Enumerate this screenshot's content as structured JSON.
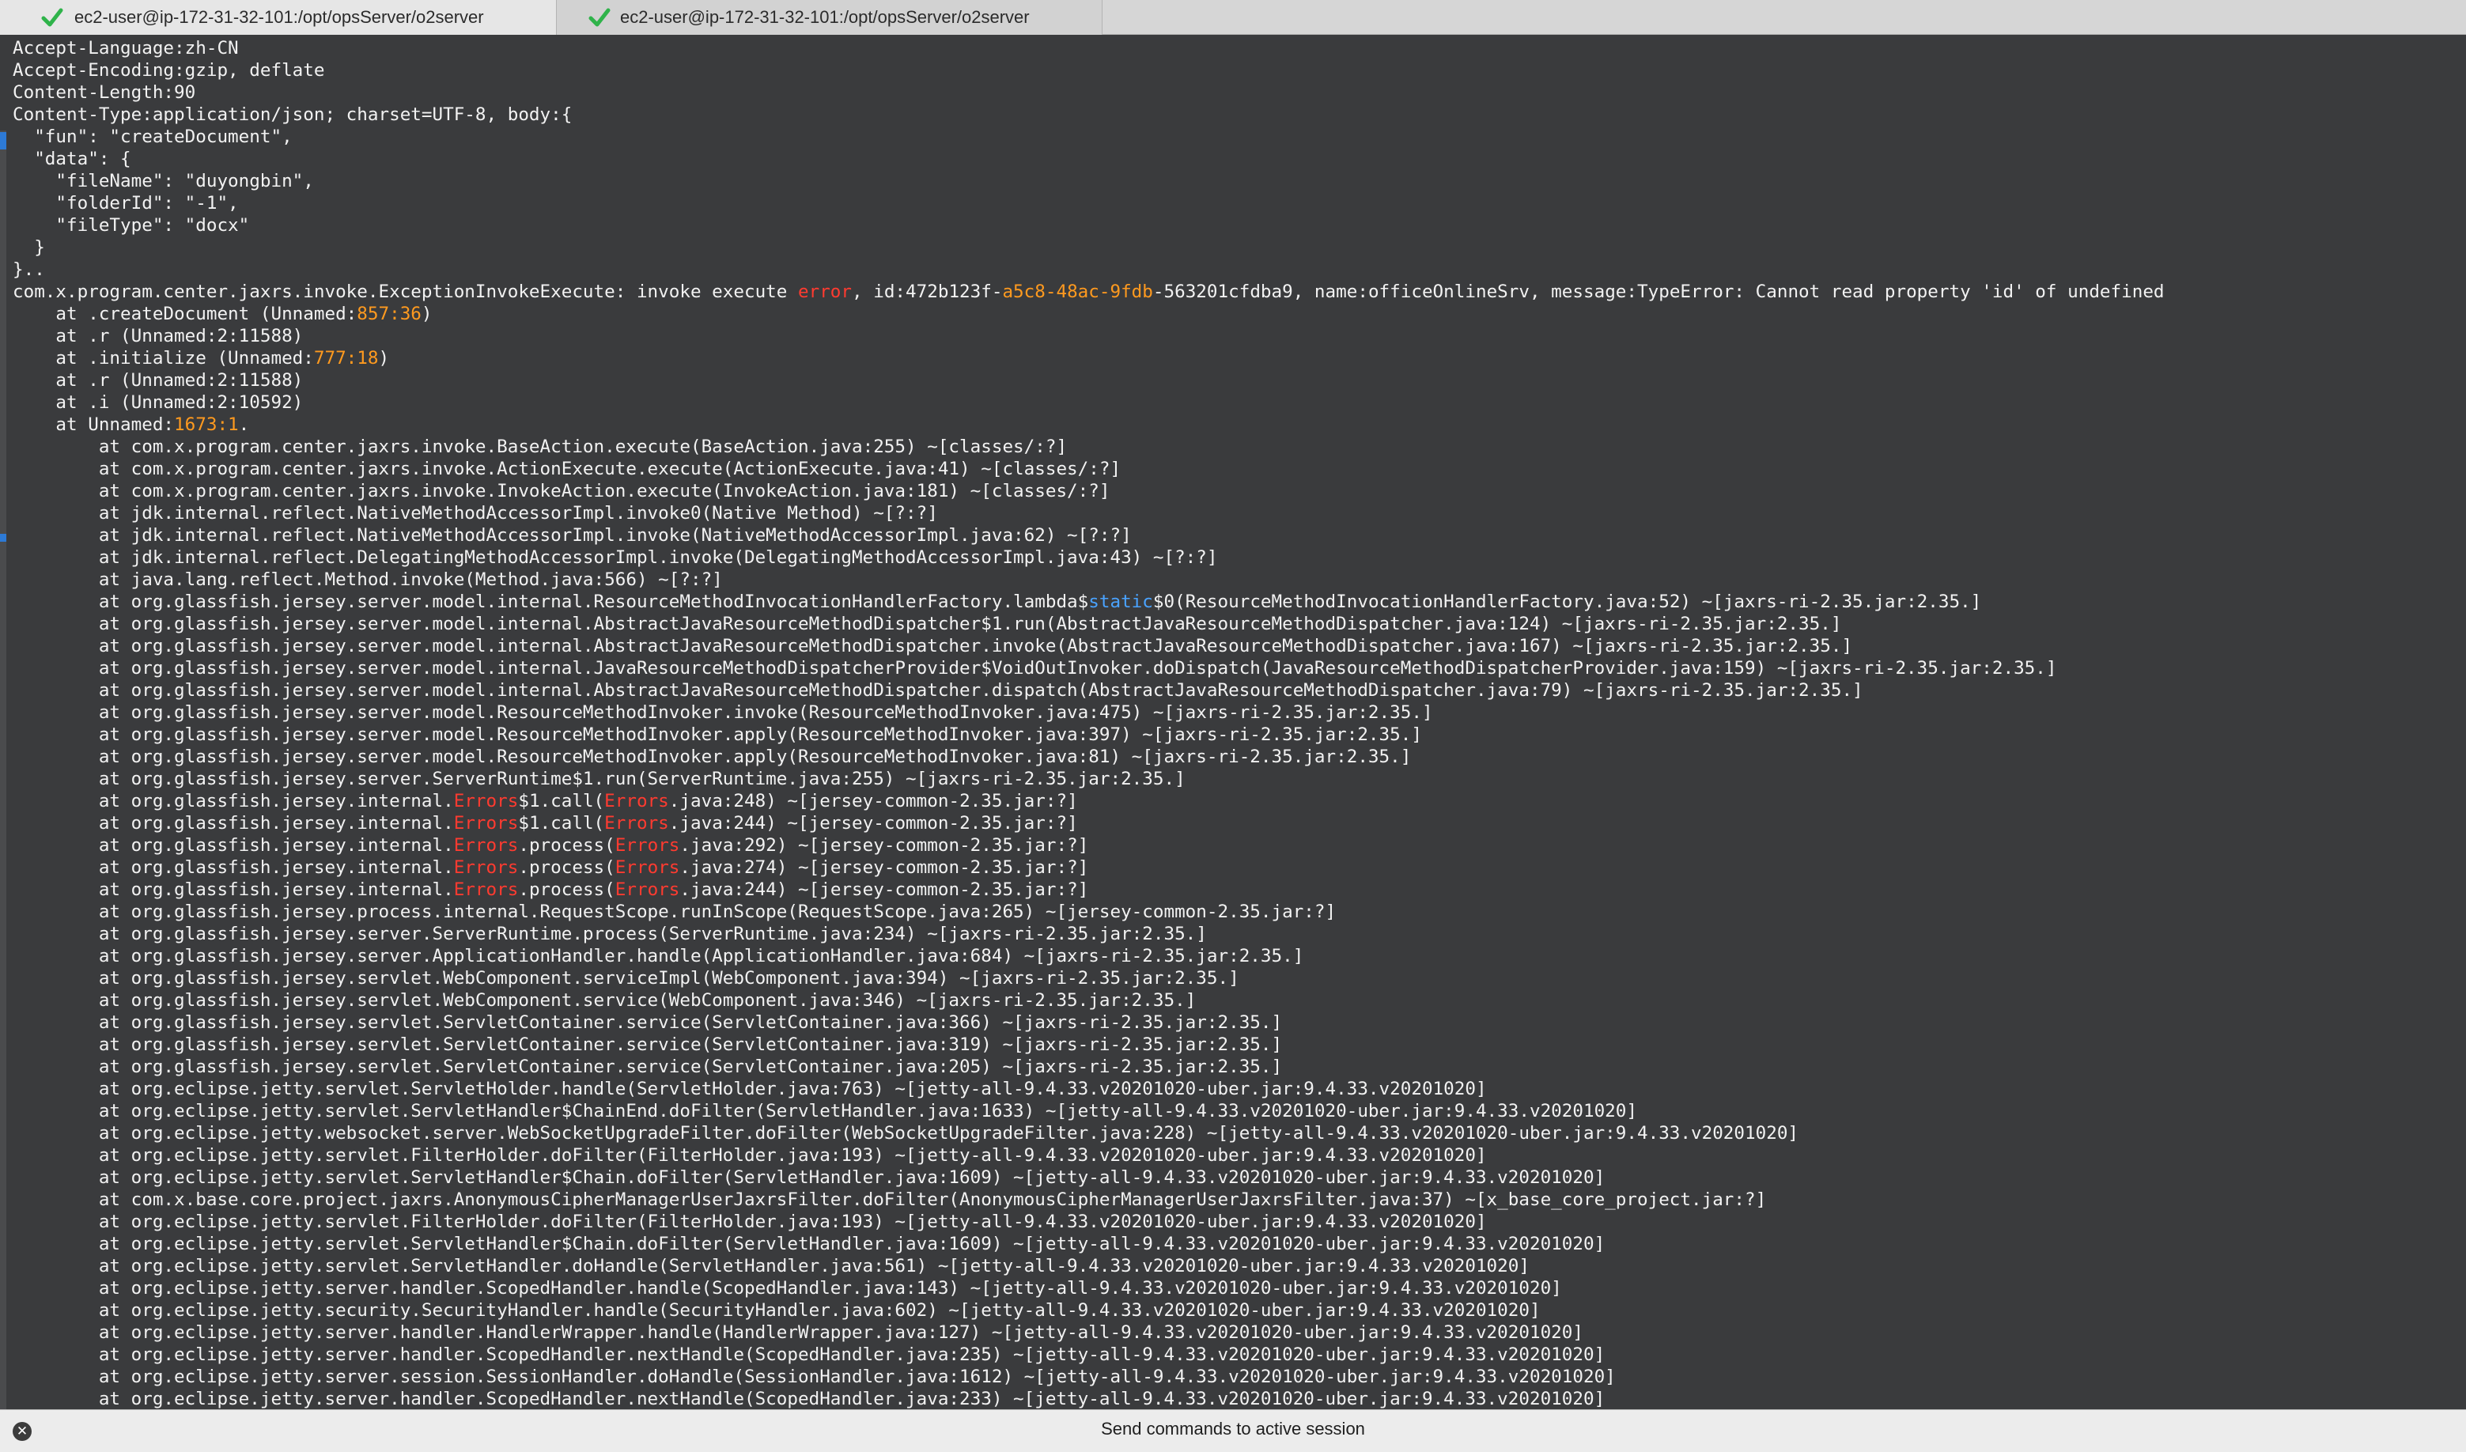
{
  "tabs": [
    {
      "label": "ec2-user@ip-172-31-32-101:/opt/opsServer/o2server",
      "status_icon": "check-icon",
      "active": true
    },
    {
      "label": "ec2-user@ip-172-31-32-101:/opt/opsServer/o2server",
      "status_icon": "check-icon",
      "active": false
    }
  ],
  "colors": {
    "terminal_bg": "#3a3b3d",
    "text": "#f2f2f2",
    "error_highlight": "#ff3b30",
    "number_highlight": "#ff9a1f",
    "keyword_highlight": "#4aa3ff",
    "check_green": "#2fb34a"
  },
  "terminal_lines": [
    [
      {
        "t": "Accept-Language:zh-CN"
      }
    ],
    [
      {
        "t": "Accept-Encoding:gzip, deflate"
      }
    ],
    [
      {
        "t": "Content-Length:90"
      }
    ],
    [
      {
        "t": "Content-Type:application/json; charset=UTF-8, body:{"
      }
    ],
    [
      {
        "t": "  \"fun\": \"createDocument\","
      }
    ],
    [
      {
        "t": "  \"data\": {"
      }
    ],
    [
      {
        "t": "    \"fileName\": \"duyongbin\","
      }
    ],
    [
      {
        "t": "    \"folderId\": \"-1\","
      }
    ],
    [
      {
        "t": "    \"fileType\": \"docx\""
      }
    ],
    [
      {
        "t": "  }"
      }
    ],
    [
      {
        "t": "}.."
      }
    ],
    [
      {
        "t": "com.x.program.center.jaxrs.invoke.ExceptionInvokeExecute: invoke execute "
      },
      {
        "t": "error",
        "c": "red"
      },
      {
        "t": ", id:472b123f-"
      },
      {
        "t": "a5c8-48ac-9fdb",
        "c": "orange"
      },
      {
        "t": "-563201cfdba9, name:officeOnlineSrv, message:TypeError: Cannot read property 'id' of undefined"
      }
    ],
    [
      {
        "t": "    at .createDocument (Unnamed:"
      },
      {
        "t": "857:36",
        "c": "orange"
      },
      {
        "t": ")"
      }
    ],
    [
      {
        "t": "    at .r (Unnamed:2:11588)"
      }
    ],
    [
      {
        "t": "    at .initialize (Unnamed:"
      },
      {
        "t": "777:18",
        "c": "orange"
      },
      {
        "t": ")"
      }
    ],
    [
      {
        "t": "    at .r (Unnamed:2:11588)"
      }
    ],
    [
      {
        "t": "    at .i (Unnamed:2:10592)"
      }
    ],
    [
      {
        "t": "    at Unnamed:"
      },
      {
        "t": "1673:1",
        "c": "orange"
      },
      {
        "t": "."
      }
    ],
    [
      {
        "t": "        at com.x.program.center.jaxrs.invoke.BaseAction.execute(BaseAction.java:255) ~[classes/:?]"
      }
    ],
    [
      {
        "t": "        at com.x.program.center.jaxrs.invoke.ActionExecute.execute(ActionExecute.java:41) ~[classes/:?]"
      }
    ],
    [
      {
        "t": "        at com.x.program.center.jaxrs.invoke.InvokeAction.execute(InvokeAction.java:181) ~[classes/:?]"
      }
    ],
    [
      {
        "t": "        at jdk.internal.reflect.NativeMethodAccessorImpl.invoke0(Native Method) ~[?:?]"
      }
    ],
    [
      {
        "t": "        at jdk.internal.reflect.NativeMethodAccessorImpl.invoke(NativeMethodAccessorImpl.java:62) ~[?:?]"
      }
    ],
    [
      {
        "t": "        at jdk.internal.reflect.DelegatingMethodAccessorImpl.invoke(DelegatingMethodAccessorImpl.java:43) ~[?:?]"
      }
    ],
    [
      {
        "t": "        at java.lang.reflect.Method.invoke(Method.java:566) ~[?:?]"
      }
    ],
    [
      {
        "t": "        at org.glassfish.jersey.server.model.internal.ResourceMethodInvocationHandlerFactory.lambda$"
      },
      {
        "t": "static",
        "c": "blue"
      },
      {
        "t": "$0(ResourceMethodInvocationHandlerFactory.java:52) ~[jaxrs-ri-2.35.jar:2.35.]"
      }
    ],
    [
      {
        "t": "        at org.glassfish.jersey.server.model.internal.AbstractJavaResourceMethodDispatcher$1.run(AbstractJavaResourceMethodDispatcher.java:124) ~[jaxrs-ri-2.35.jar:2.35.]"
      }
    ],
    [
      {
        "t": "        at org.glassfish.jersey.server.model.internal.AbstractJavaResourceMethodDispatcher.invoke(AbstractJavaResourceMethodDispatcher.java:167) ~[jaxrs-ri-2.35.jar:2.35.]"
      }
    ],
    [
      {
        "t": "        at org.glassfish.jersey.server.model.internal.JavaResourceMethodDispatcherProvider$VoidOutInvoker.doDispatch(JavaResourceMethodDispatcherProvider.java:159) ~[jaxrs-ri-2.35.jar:2.35.]"
      }
    ],
    [
      {
        "t": "        at org.glassfish.jersey.server.model.internal.AbstractJavaResourceMethodDispatcher.dispatch(AbstractJavaResourceMethodDispatcher.java:79) ~[jaxrs-ri-2.35.jar:2.35.]"
      }
    ],
    [
      {
        "t": "        at org.glassfish.jersey.server.model.ResourceMethodInvoker.invoke(ResourceMethodInvoker.java:475) ~[jaxrs-ri-2.35.jar:2.35.]"
      }
    ],
    [
      {
        "t": "        at org.glassfish.jersey.server.model.ResourceMethodInvoker.apply(ResourceMethodInvoker.java:397) ~[jaxrs-ri-2.35.jar:2.35.]"
      }
    ],
    [
      {
        "t": "        at org.glassfish.jersey.server.model.ResourceMethodInvoker.apply(ResourceMethodInvoker.java:81) ~[jaxrs-ri-2.35.jar:2.35.]"
      }
    ],
    [
      {
        "t": "        at org.glassfish.jersey.server.ServerRuntime$1.run(ServerRuntime.java:255) ~[jaxrs-ri-2.35.jar:2.35.]"
      }
    ],
    [
      {
        "t": "        at org.glassfish.jersey.internal."
      },
      {
        "t": "Errors",
        "c": "red"
      },
      {
        "t": "$1.call("
      },
      {
        "t": "Errors",
        "c": "red"
      },
      {
        "t": ".java:248) ~[jersey-common-2.35.jar:?]"
      }
    ],
    [
      {
        "t": "        at org.glassfish.jersey.internal."
      },
      {
        "t": "Errors",
        "c": "red"
      },
      {
        "t": "$1.call("
      },
      {
        "t": "Errors",
        "c": "red"
      },
      {
        "t": ".java:244) ~[jersey-common-2.35.jar:?]"
      }
    ],
    [
      {
        "t": "        at org.glassfish.jersey.internal."
      },
      {
        "t": "Errors",
        "c": "red"
      },
      {
        "t": ".process("
      },
      {
        "t": "Errors",
        "c": "red"
      },
      {
        "t": ".java:292) ~[jersey-common-2.35.jar:?]"
      }
    ],
    [
      {
        "t": "        at org.glassfish.jersey.internal."
      },
      {
        "t": "Errors",
        "c": "red"
      },
      {
        "t": ".process("
      },
      {
        "t": "Errors",
        "c": "red"
      },
      {
        "t": ".java:274) ~[jersey-common-2.35.jar:?]"
      }
    ],
    [
      {
        "t": "        at org.glassfish.jersey.internal."
      },
      {
        "t": "Errors",
        "c": "red"
      },
      {
        "t": ".process("
      },
      {
        "t": "Errors",
        "c": "red"
      },
      {
        "t": ".java:244) ~[jersey-common-2.35.jar:?]"
      }
    ],
    [
      {
        "t": "        at org.glassfish.jersey.process.internal.RequestScope.runInScope(RequestScope.java:265) ~[jersey-common-2.35.jar:?]"
      }
    ],
    [
      {
        "t": "        at org.glassfish.jersey.server.ServerRuntime.process(ServerRuntime.java:234) ~[jaxrs-ri-2.35.jar:2.35.]"
      }
    ],
    [
      {
        "t": "        at org.glassfish.jersey.server.ApplicationHandler.handle(ApplicationHandler.java:684) ~[jaxrs-ri-2.35.jar:2.35.]"
      }
    ],
    [
      {
        "t": "        at org.glassfish.jersey.servlet.WebComponent.serviceImpl(WebComponent.java:394) ~[jaxrs-ri-2.35.jar:2.35.]"
      }
    ],
    [
      {
        "t": "        at org.glassfish.jersey.servlet.WebComponent.service(WebComponent.java:346) ~[jaxrs-ri-2.35.jar:2.35.]"
      }
    ],
    [
      {
        "t": "        at org.glassfish.jersey.servlet.ServletContainer.service(ServletContainer.java:366) ~[jaxrs-ri-2.35.jar:2.35.]"
      }
    ],
    [
      {
        "t": "        at org.glassfish.jersey.servlet.ServletContainer.service(ServletContainer.java:319) ~[jaxrs-ri-2.35.jar:2.35.]"
      }
    ],
    [
      {
        "t": "        at org.glassfish.jersey.servlet.ServletContainer.service(ServletContainer.java:205) ~[jaxrs-ri-2.35.jar:2.35.]"
      }
    ],
    [
      {
        "t": "        at org.eclipse.jetty.servlet.ServletHolder.handle(ServletHolder.java:763) ~[jetty-all-9.4.33.v20201020-uber.jar:9.4.33.v20201020]"
      }
    ],
    [
      {
        "t": "        at org.eclipse.jetty.servlet.ServletHandler$ChainEnd.doFilter(ServletHandler.java:1633) ~[jetty-all-9.4.33.v20201020-uber.jar:9.4.33.v20201020]"
      }
    ],
    [
      {
        "t": "        at org.eclipse.jetty.websocket.server.WebSocketUpgradeFilter.doFilter(WebSocketUpgradeFilter.java:228) ~[jetty-all-9.4.33.v20201020-uber.jar:9.4.33.v20201020]"
      }
    ],
    [
      {
        "t": "        at org.eclipse.jetty.servlet.FilterHolder.doFilter(FilterHolder.java:193) ~[jetty-all-9.4.33.v20201020-uber.jar:9.4.33.v20201020]"
      }
    ],
    [
      {
        "t": "        at org.eclipse.jetty.servlet.ServletHandler$Chain.doFilter(ServletHandler.java:1609) ~[jetty-all-9.4.33.v20201020-uber.jar:9.4.33.v20201020]"
      }
    ],
    [
      {
        "t": "        at com.x.base.core.project.jaxrs.AnonymousCipherManagerUserJaxrsFilter.doFilter(AnonymousCipherManagerUserJaxrsFilter.java:37) ~[x_base_core_project.jar:?]"
      }
    ],
    [
      {
        "t": "        at org.eclipse.jetty.servlet.FilterHolder.doFilter(FilterHolder.java:193) ~[jetty-all-9.4.33.v20201020-uber.jar:9.4.33.v20201020]"
      }
    ],
    [
      {
        "t": "        at org.eclipse.jetty.servlet.ServletHandler$Chain.doFilter(ServletHandler.java:1609) ~[jetty-all-9.4.33.v20201020-uber.jar:9.4.33.v20201020]"
      }
    ],
    [
      {
        "t": "        at org.eclipse.jetty.servlet.ServletHandler.doHandle(ServletHandler.java:561) ~[jetty-all-9.4.33.v20201020-uber.jar:9.4.33.v20201020]"
      }
    ],
    [
      {
        "t": "        at org.eclipse.jetty.server.handler.ScopedHandler.handle(ScopedHandler.java:143) ~[jetty-all-9.4.33.v20201020-uber.jar:9.4.33.v20201020]"
      }
    ],
    [
      {
        "t": "        at org.eclipse.jetty.security.SecurityHandler.handle(SecurityHandler.java:602) ~[jetty-all-9.4.33.v20201020-uber.jar:9.4.33.v20201020]"
      }
    ],
    [
      {
        "t": "        at org.eclipse.jetty.server.handler.HandlerWrapper.handle(HandlerWrapper.java:127) ~[jetty-all-9.4.33.v20201020-uber.jar:9.4.33.v20201020]"
      }
    ],
    [
      {
        "t": "        at org.eclipse.jetty.server.handler.ScopedHandler.nextHandle(ScopedHandler.java:235) ~[jetty-all-9.4.33.v20201020-uber.jar:9.4.33.v20201020]"
      }
    ],
    [
      {
        "t": "        at org.eclipse.jetty.server.session.SessionHandler.doHandle(SessionHandler.java:1612) ~[jetty-all-9.4.33.v20201020-uber.jar:9.4.33.v20201020]"
      }
    ],
    [
      {
        "t": "        at org.eclipse.jetty.server.handler.ScopedHandler.nextHandle(ScopedHandler.java:233) ~[jetty-all-9.4.33.v20201020-uber.jar:9.4.33.v20201020]"
      }
    ]
  ],
  "command_bar": {
    "label": "Send commands to active session",
    "close_icon": "close-icon"
  }
}
